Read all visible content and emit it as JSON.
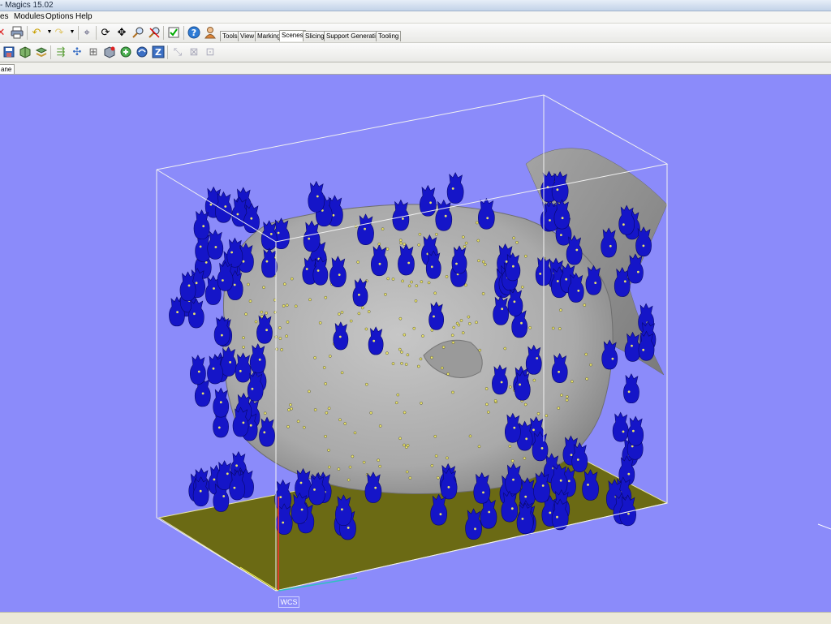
{
  "window": {
    "title": "- Magics 15.02"
  },
  "menu": {
    "items": [
      {
        "label": "es"
      },
      {
        "label": "Modules"
      },
      {
        "label": "Options"
      },
      {
        "label": "Help"
      }
    ]
  },
  "tabs": [
    {
      "label": "Tools",
      "active": false
    },
    {
      "label": "View",
      "active": false
    },
    {
      "label": "Marking",
      "active": false
    },
    {
      "label": "Scenes",
      "active": true
    },
    {
      "label": "Slicing",
      "active": false
    },
    {
      "label": "Support Generation",
      "active": false
    },
    {
      "label": "Tooling",
      "active": false
    }
  ],
  "toolbar1_icons": [
    "close-icon",
    "print-icon",
    "undo-icon",
    "redo-icon",
    "pick-icon",
    "rotate-icon",
    "pan-icon",
    "zoom-icon",
    "zoom-out-icon",
    "checklist-icon",
    "help-icon",
    "user-icon"
  ],
  "toolbar2_icons": [
    "save-part-icon",
    "export-icon",
    "import-icon",
    "arrange-icon",
    "puzzle-icon",
    "measure-icon",
    "box-icon",
    "move-icon",
    "orient-icon",
    "z-icon",
    "snap-icon",
    "snap2-icon",
    "snap3-icon"
  ],
  "view_tab": {
    "label": "ane"
  },
  "viewport": {
    "background": "#8b8bfa",
    "parts_color": "#1515c8",
    "model_color": "#a9a9a9",
    "platform_color": "#6b6a14"
  },
  "axis_label": "WCS"
}
